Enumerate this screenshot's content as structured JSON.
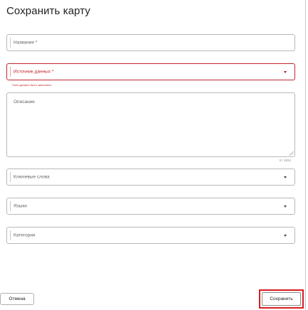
{
  "dialog": {
    "title": "Сохранить карту"
  },
  "form": {
    "name_label": "Название *",
    "source_label": "Источник данных *",
    "source_error": "Поле должно быть заполнено",
    "description_label": "Описание",
    "description_counter": "0 / 1024",
    "keywords_label": "Ключевые слова",
    "languages_label": "Языки",
    "categories_label": "Категории"
  },
  "footer": {
    "cancel_label": "Отмена",
    "save_label": "Сохранить"
  },
  "colors": {
    "error": "#c0272d",
    "highlight": "#d81b20"
  }
}
